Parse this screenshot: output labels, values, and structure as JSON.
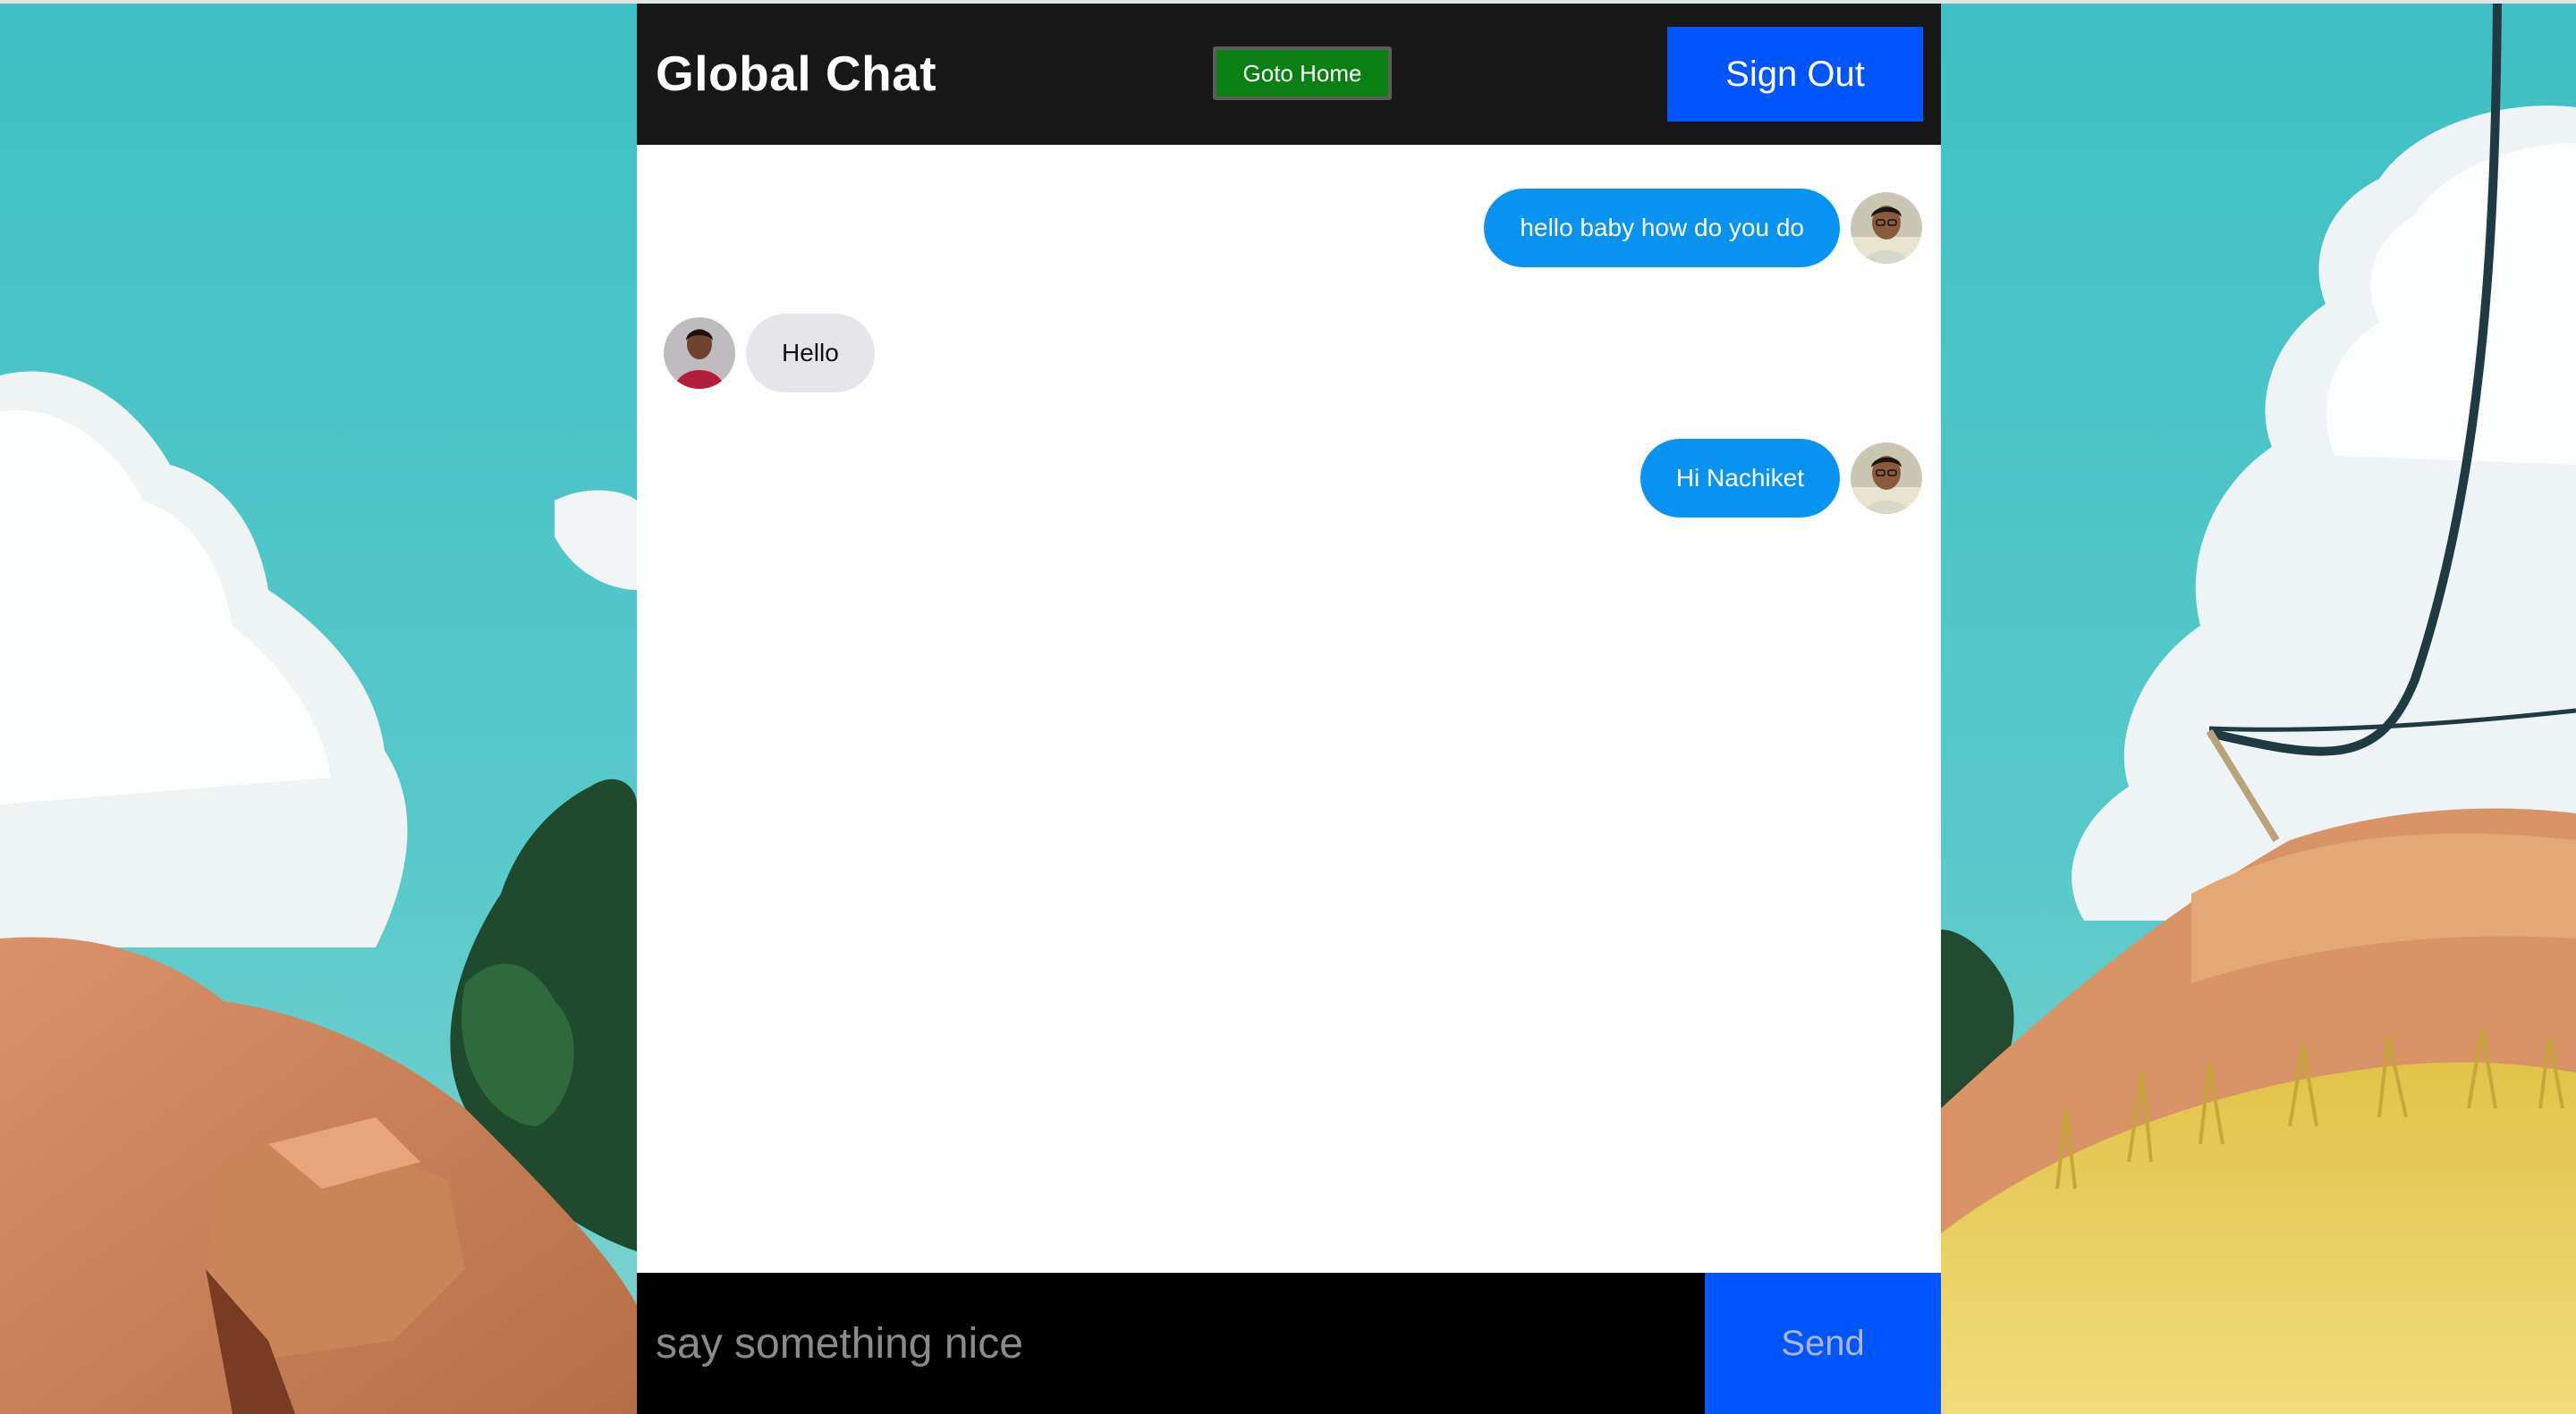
{
  "header": {
    "title": "Global Chat",
    "home_label": "Goto Home",
    "signout_label": "Sign Out"
  },
  "messages": [
    {
      "text": "hello baby how do you do",
      "direction": "sent"
    },
    {
      "text": "Hello",
      "direction": "received"
    },
    {
      "text": "Hi Nachiket",
      "direction": "sent"
    }
  ],
  "composer": {
    "placeholder": "say something nice",
    "value": "",
    "send_label": "Send"
  },
  "colors": {
    "header_bg": "#181818",
    "home_button": "#0a7f14",
    "accent_blue": "#0055ff",
    "sent_bubble": "#0893f2",
    "received_bubble": "#e6e6ea",
    "sky": "#4ec3c6"
  },
  "icons": [
    "user-avatar-icon",
    "contact-avatar-icon"
  ]
}
